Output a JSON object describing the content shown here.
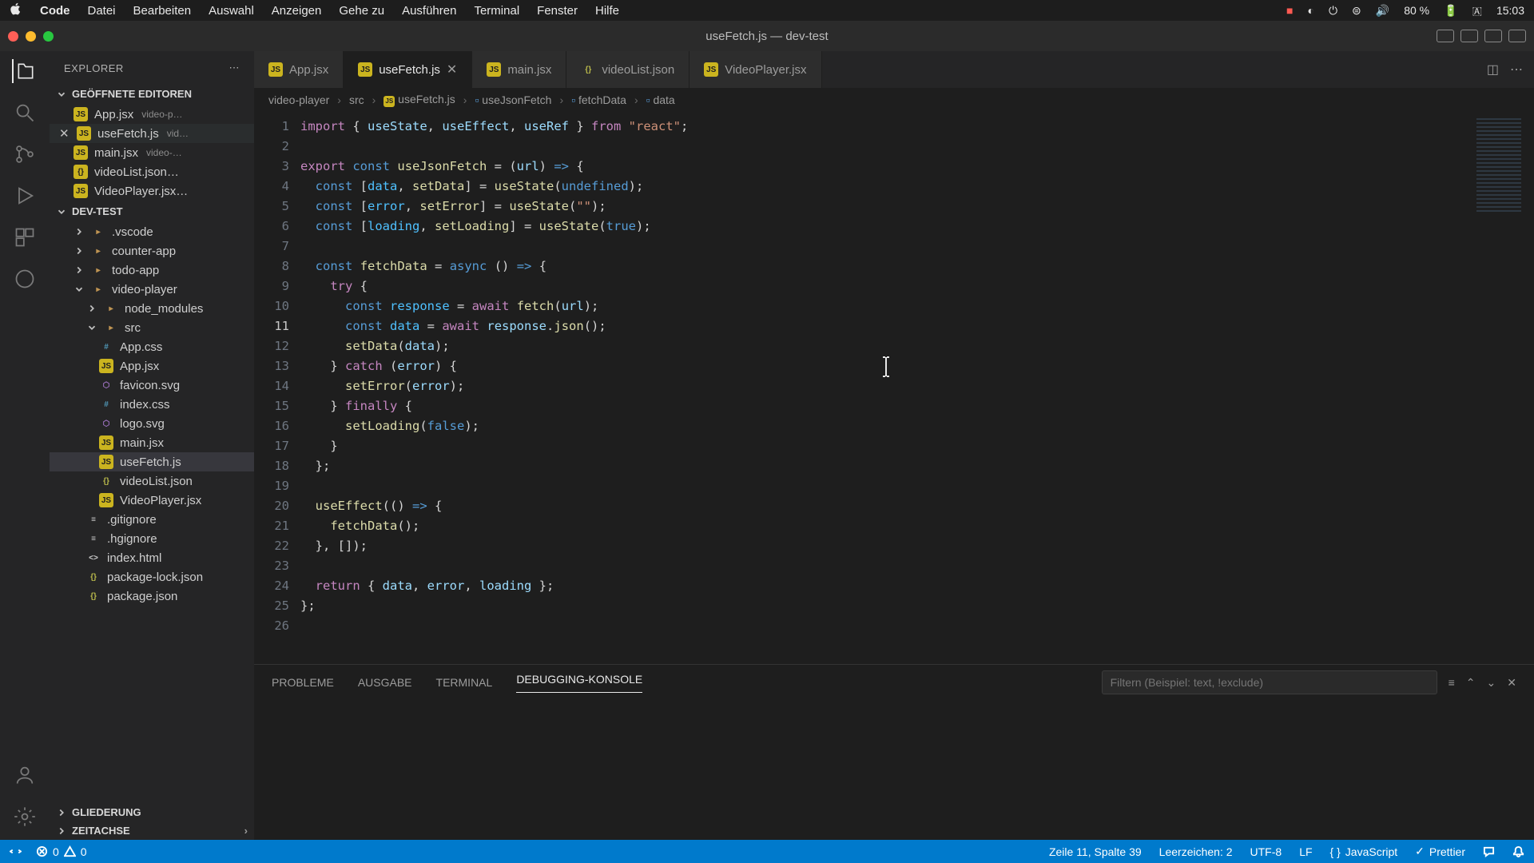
{
  "menubar": {
    "appName": "Code",
    "items": [
      "Datei",
      "Bearbeiten",
      "Auswahl",
      "Anzeigen",
      "Gehe zu",
      "Ausführen",
      "Terminal",
      "Fenster",
      "Hilfe"
    ],
    "right": {
      "battery": "80 %",
      "batteryIcon": "⚡︎",
      "time": "15:03",
      "lang": "🇩🇪"
    }
  },
  "window": {
    "title": "useFetch.js — dev-test"
  },
  "explorer": {
    "title": "EXPLORER",
    "openEditors": {
      "label": "GEÖFFNETE EDITOREN",
      "items": [
        {
          "name": "App.jsx",
          "hint": "video-p…",
          "icon": "JS"
        },
        {
          "name": "useFetch.js",
          "hint": "vid…",
          "icon": "JS",
          "active": true
        },
        {
          "name": "main.jsx",
          "hint": "video-…",
          "icon": "JS"
        },
        {
          "name": "videoList.json…",
          "hint": "",
          "icon": "{}"
        },
        {
          "name": "VideoPlayer.jsx…",
          "hint": "",
          "icon": "JS"
        }
      ]
    },
    "project": {
      "label": "DEV-TEST",
      "tree": [
        {
          "name": ".vscode",
          "type": "folder",
          "lvl": 1
        },
        {
          "name": "counter-app",
          "type": "folder",
          "lvl": 1
        },
        {
          "name": "todo-app",
          "type": "folder",
          "lvl": 1
        },
        {
          "name": "video-player",
          "type": "folder",
          "lvl": 1,
          "open": true
        },
        {
          "name": "node_modules",
          "type": "folder",
          "lvl": 2
        },
        {
          "name": "src",
          "type": "folder",
          "lvl": 2,
          "open": true
        },
        {
          "name": "App.css",
          "type": "css",
          "lvl": 3
        },
        {
          "name": "App.jsx",
          "type": "js",
          "lvl": 3
        },
        {
          "name": "favicon.svg",
          "type": "svg",
          "lvl": 3
        },
        {
          "name": "index.css",
          "type": "css",
          "lvl": 3
        },
        {
          "name": "logo.svg",
          "type": "svg",
          "lvl": 3
        },
        {
          "name": "main.jsx",
          "type": "js",
          "lvl": 3
        },
        {
          "name": "useFetch.js",
          "type": "js",
          "lvl": 3,
          "selected": true
        },
        {
          "name": "videoList.json",
          "type": "json",
          "lvl": 3
        },
        {
          "name": "VideoPlayer.jsx",
          "type": "js",
          "lvl": 3
        },
        {
          "name": ".gitignore",
          "type": "file",
          "lvl": 2
        },
        {
          "name": ".hgignore",
          "type": "file",
          "lvl": 2
        },
        {
          "name": "index.html",
          "type": "html",
          "lvl": 2
        },
        {
          "name": "package-lock.json",
          "type": "json",
          "lvl": 2
        },
        {
          "name": "package.json",
          "type": "json",
          "lvl": 2
        }
      ]
    },
    "outline": "GLIEDERUNG",
    "timeline": "ZEITACHSE"
  },
  "tabs": [
    {
      "label": "App.jsx",
      "icon": "JS"
    },
    {
      "label": "useFetch.js",
      "icon": "JS",
      "active": true,
      "closable": true
    },
    {
      "label": "main.jsx",
      "icon": "JS"
    },
    {
      "label": "videoList.json",
      "icon": "{}"
    },
    {
      "label": "VideoPlayer.jsx",
      "icon": "JS"
    }
  ],
  "breadcrumbs": [
    "video-player",
    "src",
    "useFetch.js",
    "useJsonFetch",
    "fetchData",
    "data"
  ],
  "code": {
    "lines": 26
  },
  "panel": {
    "tabs": [
      "PROBLEME",
      "AUSGABE",
      "TERMINAL",
      "DEBUGGING-KONSOLE"
    ],
    "active": "DEBUGGING-KONSOLE",
    "filterPlaceholder": "Filtern (Beispiel: text, !exclude)"
  },
  "statusbar": {
    "errors": "0",
    "warnings": "0",
    "cursor": "Zeile 11, Spalte 39",
    "spaces": "Leerzeichen: 2",
    "encoding": "UTF-8",
    "eol": "LF",
    "language": "JavaScript",
    "prettier": "Prettier"
  }
}
